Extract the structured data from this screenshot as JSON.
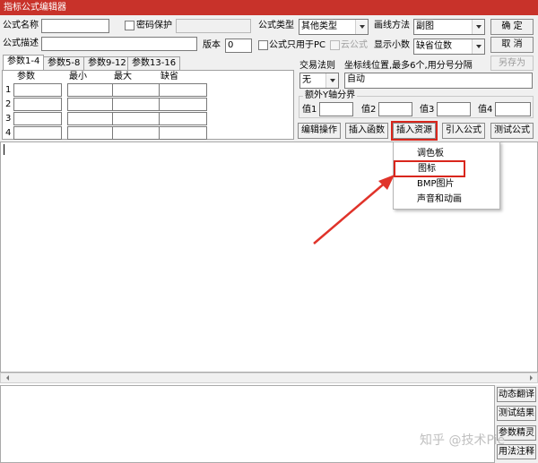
{
  "window": {
    "title": "指标公式编辑器"
  },
  "form": {
    "formula_name_label": "公式名称",
    "formula_name_value": "",
    "password_label": "密码保护",
    "password_value": "",
    "formula_desc_label": "公式描述",
    "formula_desc_value": "",
    "version_label": "版本",
    "version_value": "0",
    "formula_type_label": "公式类型",
    "formula_type_value": "其他类型",
    "draw_method_label": "画线方法",
    "draw_method_value": "副图",
    "pc_only_label": "公式只用于PC",
    "cloud_label": "云公式",
    "decimal_label": "显示小数",
    "decimal_value": "缺省位数",
    "trade_rule_label": "交易法则",
    "trade_rule_value": "无",
    "axis_desc_label": "坐标线位置,最多6个,用分号分隔",
    "axis_value": "自动",
    "extra_y_label": "额外Y轴分界",
    "val1_label": "值1",
    "val2_label": "值2",
    "val3_label": "值3",
    "val4_label": "值4"
  },
  "buttons": {
    "ok": "确 定",
    "cancel": "取 消",
    "save_as": "另存为",
    "edit_ops": "编辑操作",
    "insert_func": "插入函数",
    "insert_resource": "插入资源",
    "import_formula": "引入公式",
    "test_formula": "测试公式"
  },
  "tabs": [
    {
      "label": "参数1-4"
    },
    {
      "label": "参数5-8"
    },
    {
      "label": "参数9-12"
    },
    {
      "label": "参数13-16"
    }
  ],
  "param_table": {
    "headers": [
      "参数",
      "最小",
      "最大",
      "缺省"
    ],
    "rows": [
      "1",
      "2",
      "3",
      "4"
    ]
  },
  "context_menu": {
    "items": [
      {
        "label": "调色板"
      },
      {
        "label": "图标"
      },
      {
        "label": "BMP图片"
      },
      {
        "label": "声音和动画"
      }
    ]
  },
  "side_buttons": {
    "dynamic_translate": "动态翻译",
    "test_result": "测试结果",
    "param_wizard": "参数精灵",
    "usage_notes": "用法注释"
  },
  "watermark": "知乎 @技术Pie",
  "colors": {
    "title_bar": "#c8322a",
    "highlight": "#d9261c",
    "arrow": "#e0332a"
  }
}
